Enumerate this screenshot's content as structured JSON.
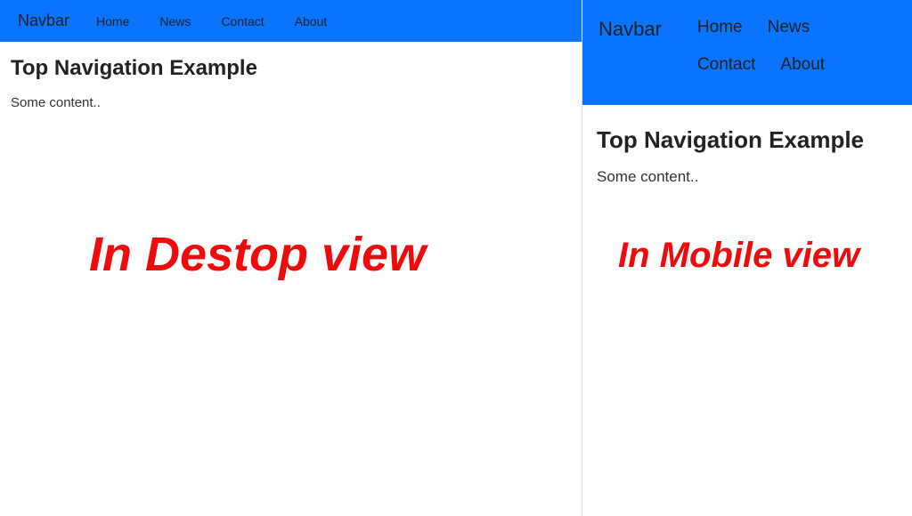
{
  "nav": {
    "brand": "Navbar",
    "links": [
      "Home",
      "News",
      "Contact",
      "About"
    ]
  },
  "main": {
    "heading": "Top Navigation Example",
    "body": "Some content.."
  },
  "captions": {
    "desktop": "In Destop view",
    "mobile": "In Mobile view"
  }
}
